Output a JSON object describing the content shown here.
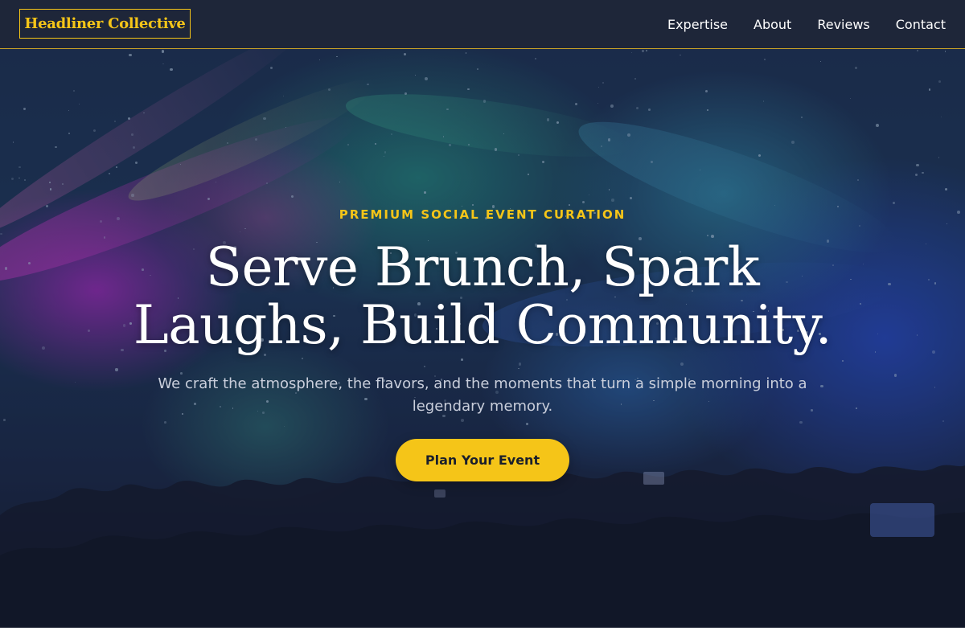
{
  "header": {
    "brand": "Headliner Collective",
    "nav": [
      "Expertise",
      "About",
      "Reviews",
      "Contact"
    ]
  },
  "hero": {
    "eyebrow": "PREMIUM SOCIAL EVENT CURATION",
    "headline_line1": "Serve Brunch, Spark",
    "headline_line2": "Laughs, Build Community.",
    "subheadline": "We craft the atmosphere, the flavors, and the moments that turn a simple morning into a legendary memory.",
    "cta_label": "Plan Your Event",
    "background_image": "concert-crowd-photo"
  },
  "colors": {
    "header_bg": "#1e2639",
    "accent": "#f5c518",
    "headline": "#ffffff",
    "subtext": "#c9cedb",
    "cta_text": "#1a1f2c"
  }
}
